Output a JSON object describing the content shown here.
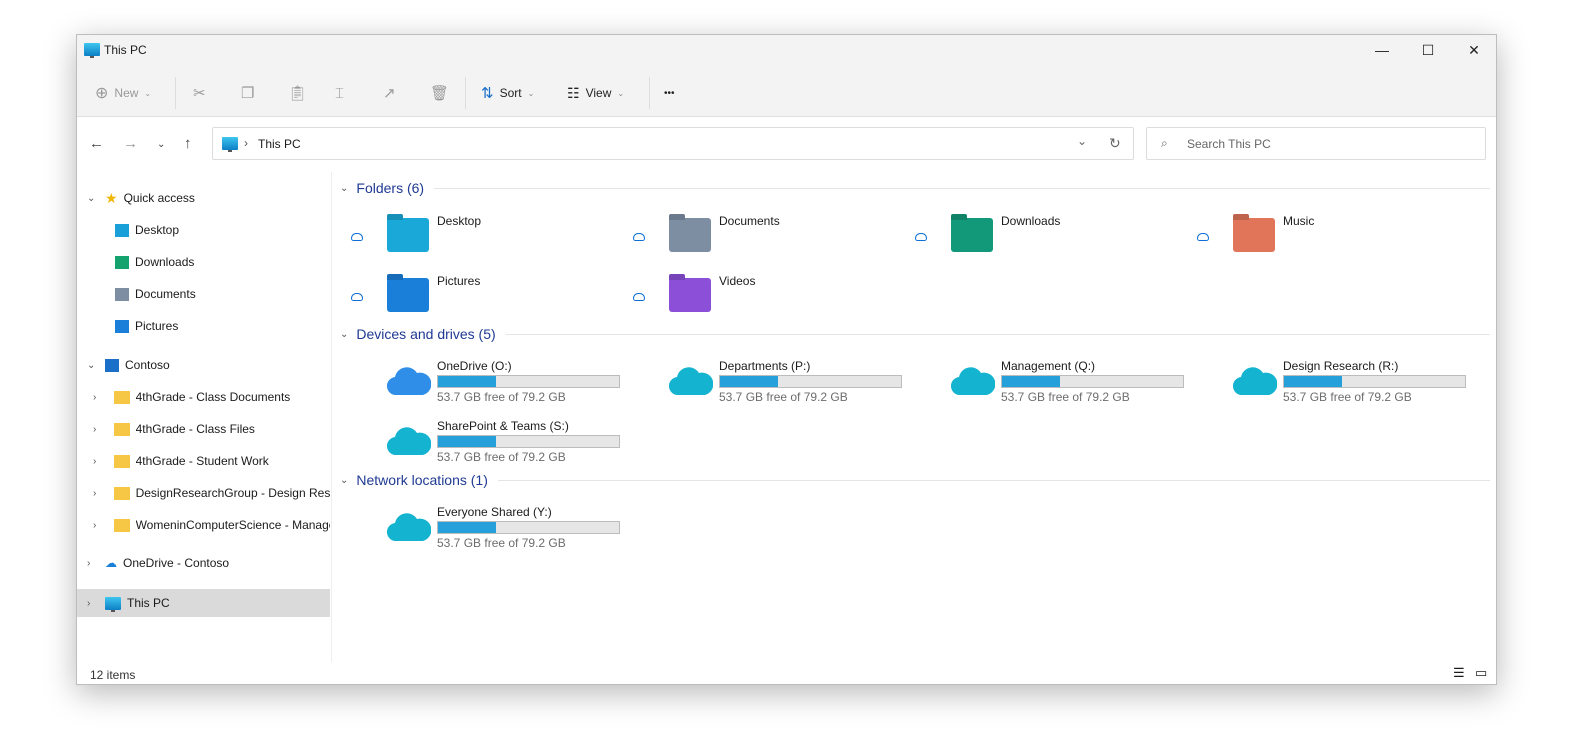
{
  "window": {
    "title": "This PC",
    "minimize": "—",
    "maximize": "☐",
    "close": "✕"
  },
  "toolbar": {
    "new": "New",
    "sort": "Sort",
    "view": "View",
    "more": "•••"
  },
  "address": {
    "path": "This PC",
    "search_placeholder": "Search This PC"
  },
  "sidebar": {
    "quick_access": "Quick access",
    "quick_items": [
      {
        "label": "Desktop",
        "color": "#1aa0d8"
      },
      {
        "label": "Downloads",
        "color": "#14a36f"
      },
      {
        "label": "Documents",
        "color": "#7d8ea3"
      },
      {
        "label": "Pictures",
        "color": "#1a7fd8"
      }
    ],
    "contoso": "Contoso",
    "contoso_items": [
      "4thGrade - Class Documents",
      "4thGrade - Class Files",
      "4thGrade - Student Work",
      "DesignResearchGroup - Design Resea",
      "WomeninComputerScience - Manage"
    ],
    "onedrive": "OneDrive - Contoso",
    "this_pc": "This PC"
  },
  "sections": {
    "folders": "Folders (6)",
    "devices": "Devices and drives (5)",
    "network": "Network locations (1)"
  },
  "folders": [
    {
      "name": "Desktop",
      "color": "#1aa8d8"
    },
    {
      "name": "Documents",
      "color": "#7d8ea3"
    },
    {
      "name": "Downloads",
      "color": "#12997a"
    },
    {
      "name": "Music",
      "color": "#e0755a"
    },
    {
      "name": "Pictures",
      "color": "#1a7fd8"
    },
    {
      "name": "Videos",
      "color": "#8b4fd8"
    }
  ],
  "drives": [
    {
      "name": "OneDrive (O:)",
      "free": "53.7 GB free of 79.2 GB",
      "used_fraction": 0.32,
      "color": "#2f8fe8"
    },
    {
      "name": "Departments (P:)",
      "free": "53.7 GB free of 79.2 GB",
      "used_fraction": 0.32,
      "color": "#14b3cf"
    },
    {
      "name": "Management (Q:)",
      "free": "53.7 GB free of 79.2 GB",
      "used_fraction": 0.32,
      "color": "#14b3cf"
    },
    {
      "name": "Design Research (R:)",
      "free": "53.7 GB free of 79.2 GB",
      "used_fraction": 0.32,
      "color": "#14b3cf"
    },
    {
      "name": "SharePoint & Teams (S:)",
      "free": "53.7 GB free of 79.2 GB",
      "used_fraction": 0.32,
      "color": "#14b3cf"
    }
  ],
  "network": [
    {
      "name": "Everyone Shared (Y:)",
      "free": "53.7 GB free of 79.2 GB",
      "used_fraction": 0.32,
      "color": "#14b3cf"
    }
  ],
  "status": {
    "items": "12 items"
  }
}
